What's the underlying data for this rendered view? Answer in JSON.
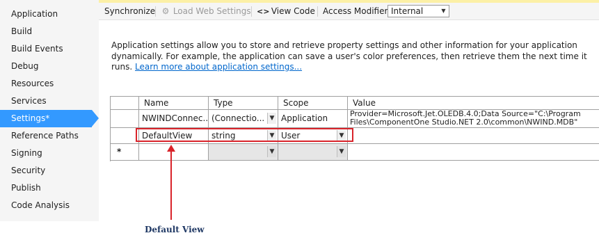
{
  "sidebar": {
    "items": [
      {
        "label": "Application"
      },
      {
        "label": "Build"
      },
      {
        "label": "Build Events"
      },
      {
        "label": "Debug"
      },
      {
        "label": "Resources"
      },
      {
        "label": "Services"
      },
      {
        "label": "Settings*"
      },
      {
        "label": "Reference Paths"
      },
      {
        "label": "Signing"
      },
      {
        "label": "Security"
      },
      {
        "label": "Publish"
      },
      {
        "label": "Code Analysis"
      }
    ],
    "selected_index": 6,
    "selected_color": "#3399ff"
  },
  "toolbar": {
    "synchronize": "Synchronize",
    "load_web_settings": "Load Web Settings",
    "view_code_icon": "<>",
    "view_code": "View Code",
    "access_modifier_label": "Access Modifier:",
    "access_modifier_value": "Internal"
  },
  "description": {
    "text": "Application settings allow you to store and retrieve property settings and other information for your application dynamically. For example, the application can save a user's color preferences, then retrieve them the next time it runs.",
    "link": "Learn more about application settings..."
  },
  "grid": {
    "columns": [
      "Name",
      "Type",
      "Scope",
      "Value"
    ],
    "rows": [
      {
        "name": "NWINDConnec...",
        "type": "(Connectio...",
        "scope": "Application",
        "value_line1": "Provider=Microsoft.Jet.OLEDB.4.0;Data Source=\"C:\\Program",
        "value_line2": "Files\\ComponentOne Studio.NET 2.0\\common\\NWIND.MDB\""
      },
      {
        "name": "DefaultView",
        "type": "string",
        "scope": "User",
        "value_line1": "",
        "value_line2": ""
      }
    ],
    "new_row_marker": "*"
  },
  "annotation": {
    "caption": "Default View",
    "color": "#d9232a"
  }
}
